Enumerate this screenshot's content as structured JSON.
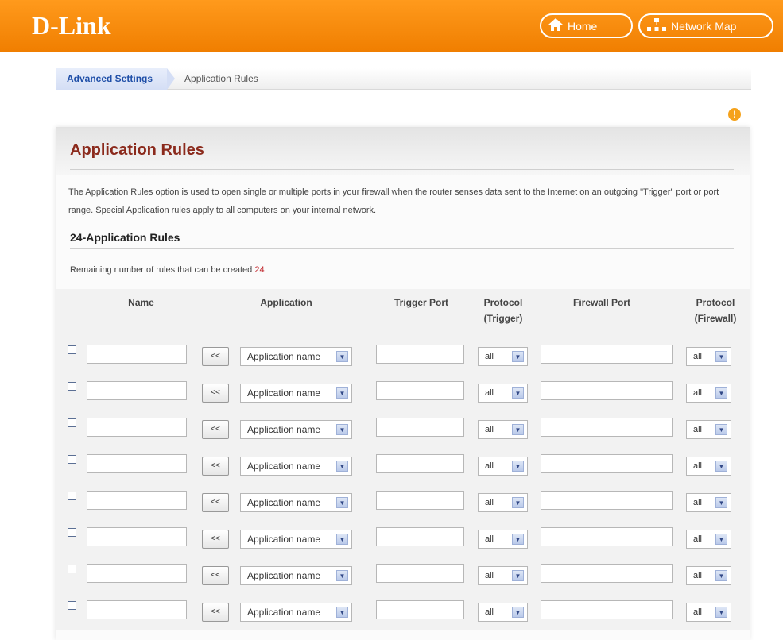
{
  "header": {
    "logo": "D-Link",
    "home_label": "Home",
    "network_map_label": "Network Map"
  },
  "breadcrumb": {
    "first": "Advanced Settings",
    "second": "Application Rules"
  },
  "page": {
    "title": "Application Rules",
    "description": "The Application Rules option is used to open single or multiple ports in your firewall when the router senses data sent to the Internet on an outgoing \"Trigger\" port or port range. Special Application rules apply to all computers on your internal network.",
    "section_title": "24-Application Rules",
    "remaining_label": "Remaining number of rules that can be created",
    "remaining_count": "24"
  },
  "table": {
    "headers": {
      "name": "Name",
      "application": "Application",
      "trigger_port": "Trigger Port",
      "protocol_trigger": [
        "Protocol",
        "(Trigger)"
      ],
      "firewall_port": "Firewall Port",
      "protocol_firewall": [
        "Protocol",
        "(Firewall)"
      ]
    },
    "copy_button_label": "<<",
    "rows": [
      {
        "name": "",
        "application": "Application name",
        "trigger_port": "",
        "protocol_trigger": "all",
        "firewall_port": "",
        "protocol_firewall": "all"
      },
      {
        "name": "",
        "application": "Application name",
        "trigger_port": "",
        "protocol_trigger": "all",
        "firewall_port": "",
        "protocol_firewall": "all"
      },
      {
        "name": "",
        "application": "Application name",
        "trigger_port": "",
        "protocol_trigger": "all",
        "firewall_port": "",
        "protocol_firewall": "all"
      },
      {
        "name": "",
        "application": "Application name",
        "trigger_port": "",
        "protocol_trigger": "all",
        "firewall_port": "",
        "protocol_firewall": "all"
      },
      {
        "name": "",
        "application": "Application name",
        "trigger_port": "",
        "protocol_trigger": "all",
        "firewall_port": "",
        "protocol_firewall": "all"
      },
      {
        "name": "",
        "application": "Application name",
        "trigger_port": "",
        "protocol_trigger": "all",
        "firewall_port": "",
        "protocol_firewall": "all"
      },
      {
        "name": "",
        "application": "Application name",
        "trigger_port": "",
        "protocol_trigger": "all",
        "firewall_port": "",
        "protocol_firewall": "all"
      },
      {
        "name": "",
        "application": "Application name",
        "trigger_port": "",
        "protocol_trigger": "all",
        "firewall_port": "",
        "protocol_firewall": "all"
      }
    ]
  },
  "colors": {
    "header_orange": "#f58a0e",
    "title_red": "#8b2a1c",
    "link_blue": "#1f4fa8",
    "count_red": "#c1272d"
  }
}
